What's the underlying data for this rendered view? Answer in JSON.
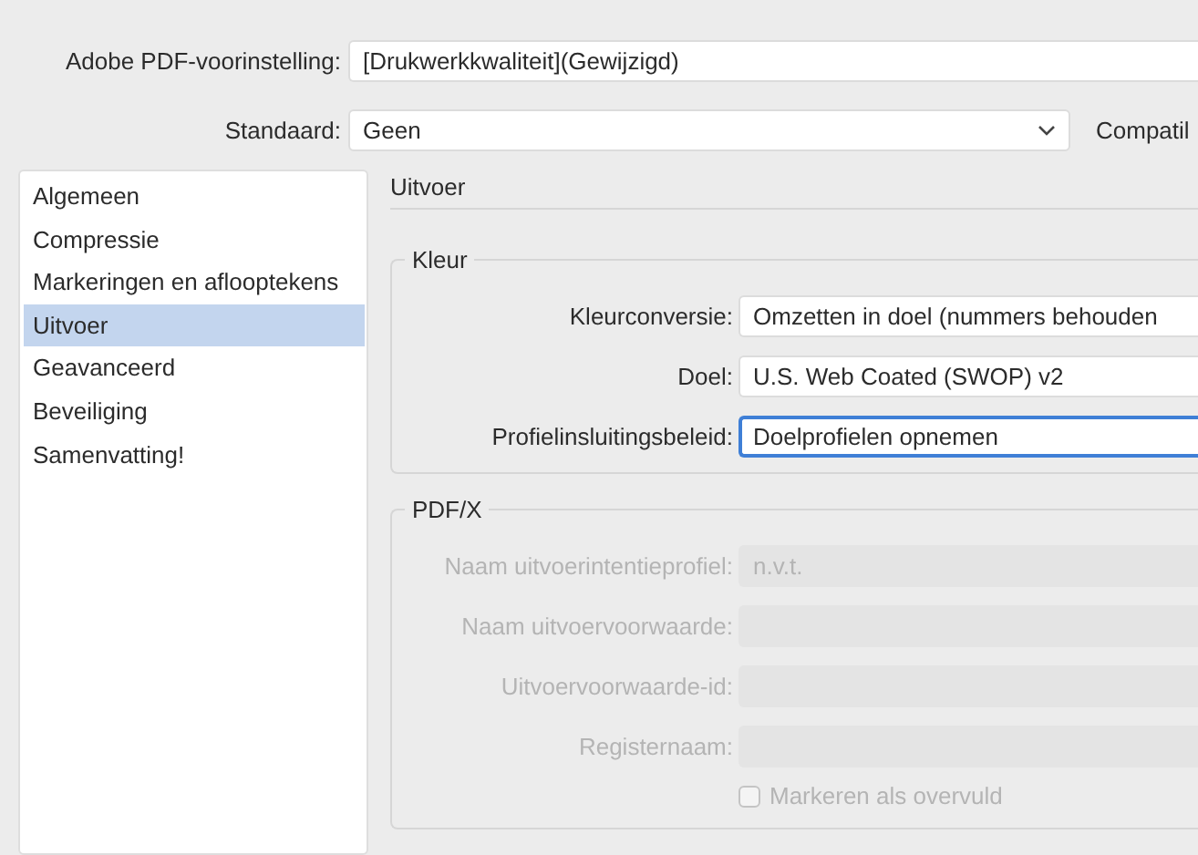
{
  "preset": {
    "label": "Adobe PDF-voorinstelling:",
    "value": "[Drukwerkkwaliteit](Gewijzigd)"
  },
  "standard": {
    "label": "Standaard:",
    "value": "Geen"
  },
  "compatibility": {
    "label": "Compatil"
  },
  "sidebar": {
    "items": [
      {
        "label": "Algemeen",
        "selected": false
      },
      {
        "label": "Compressie",
        "selected": false
      },
      {
        "label": "Markeringen en aflooptekens",
        "selected": false
      },
      {
        "label": "Uitvoer",
        "selected": true
      },
      {
        "label": "Geavanceerd",
        "selected": false
      },
      {
        "label": "Beveiliging",
        "selected": false
      },
      {
        "label": "Samenvatting!",
        "selected": false
      }
    ]
  },
  "panel": {
    "title": "Uitvoer",
    "groups": [
      {
        "title": "Kleur",
        "fields": [
          {
            "kind": "field",
            "label": "Kleurconversie:",
            "value": "Omzetten in doel (nummers behouden",
            "disabled": false,
            "focused": false
          },
          {
            "kind": "field",
            "label": "Doel:",
            "value": "U.S. Web Coated (SWOP) v2",
            "disabled": false,
            "focused": false
          },
          {
            "kind": "field",
            "label": "Profielinsluitingsbeleid:",
            "value": "Doelprofielen opnemen",
            "disabled": false,
            "focused": true
          }
        ]
      },
      {
        "title": "PDF/X",
        "fields": [
          {
            "kind": "field",
            "label": "Naam uitvoerintentieprofiel:",
            "value": "n.v.t.",
            "disabled": true
          },
          {
            "kind": "field",
            "label": "Naam uitvoervoorwaarde:",
            "disabled": true
          },
          {
            "kind": "field",
            "label": "Uitvoervoorwaarde-id:",
            "disabled": true
          },
          {
            "kind": "field",
            "label": "Registernaam:",
            "disabled": true
          },
          {
            "kind": "checkbox",
            "label": "Markeren als overvuld",
            "checked": false,
            "disabled": true
          }
        ]
      }
    ]
  }
}
